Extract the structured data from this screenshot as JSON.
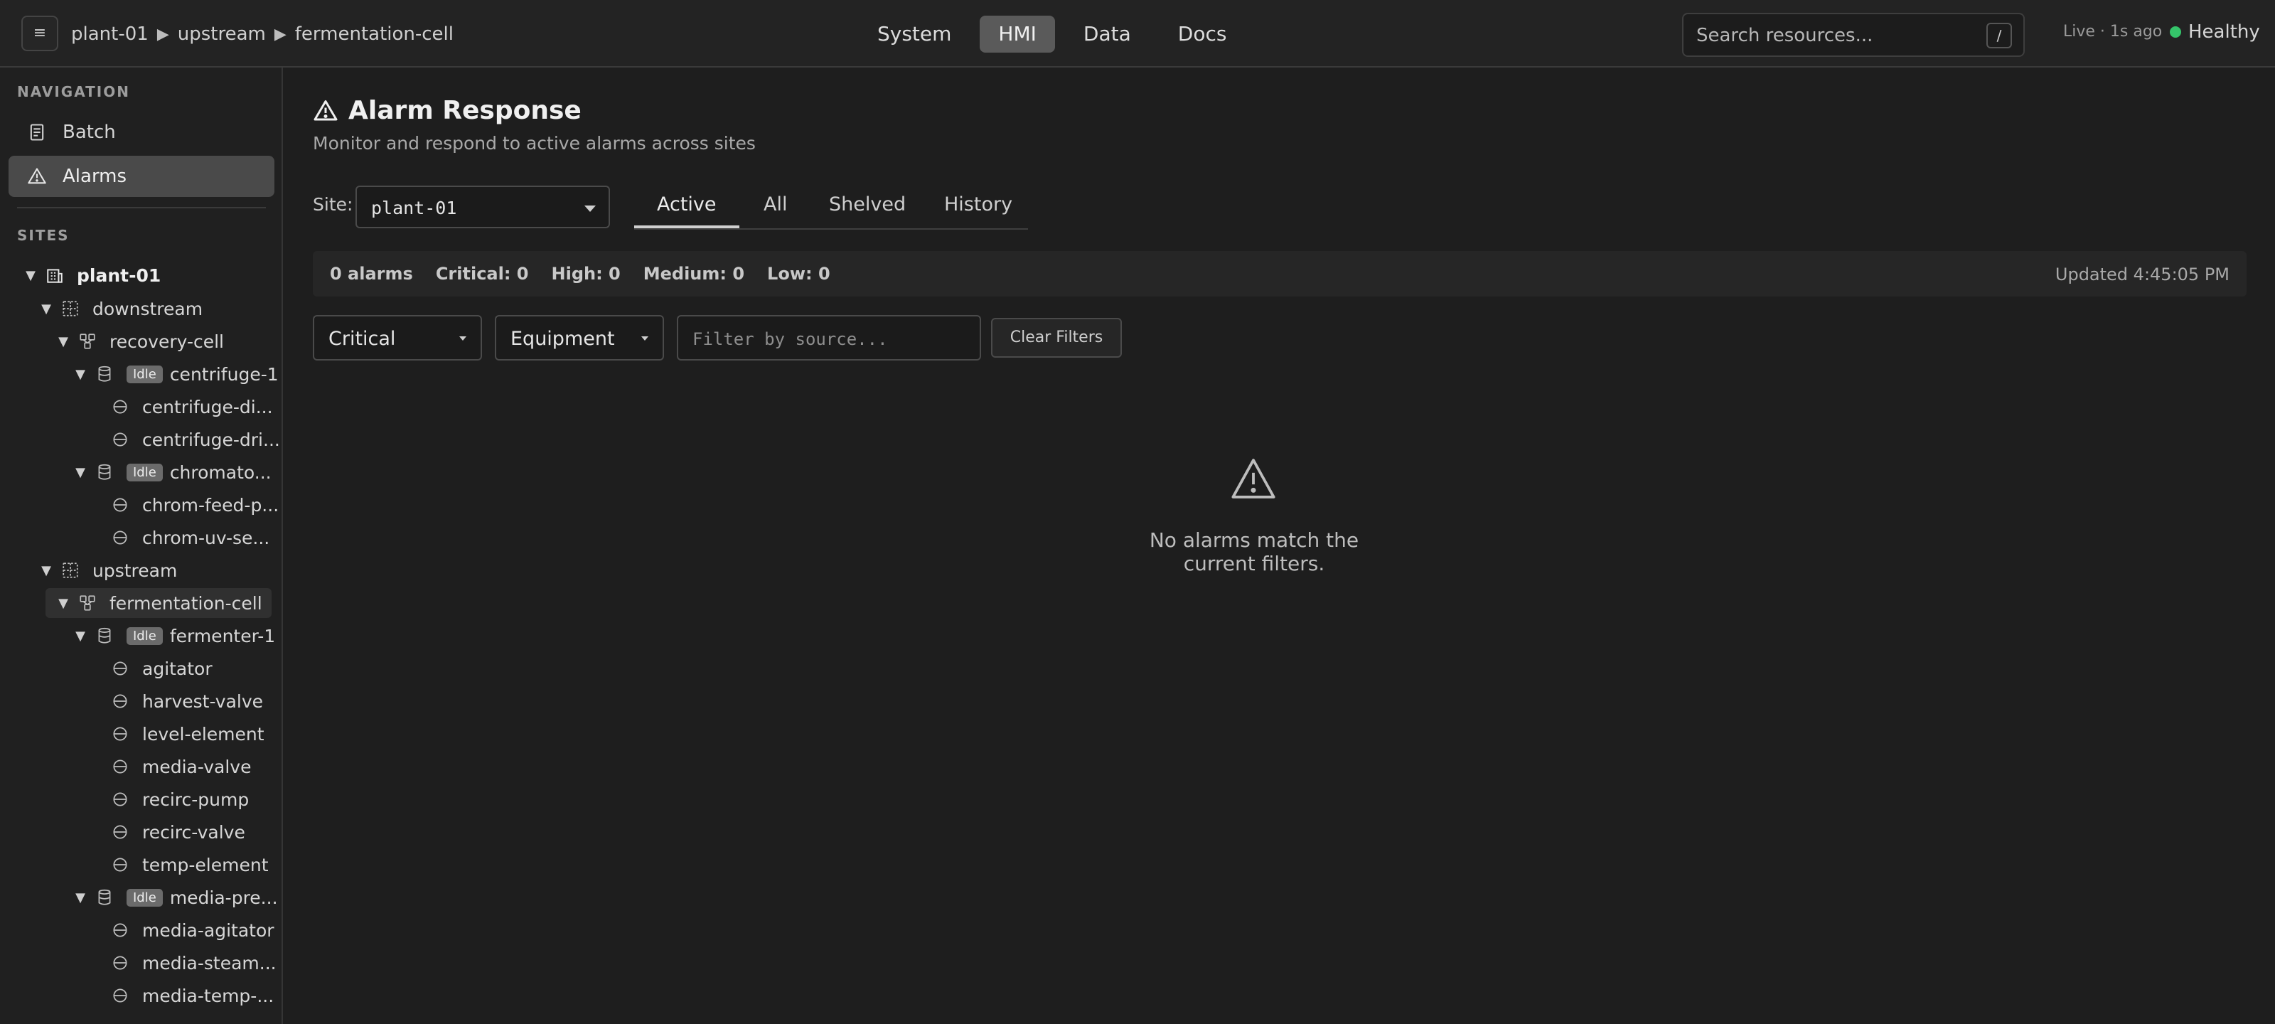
{
  "topbar": {
    "menu_glyph": "≡",
    "breadcrumb": [
      "plant-01",
      "upstream",
      "fermentation-cell"
    ],
    "nav": [
      "System",
      "HMI",
      "Data",
      "Docs"
    ],
    "nav_active": "HMI",
    "search_placeholder": "Search resources...",
    "search_shortcut": "/",
    "live_status": "Live · 1s ago",
    "health": "Healthy",
    "health_color": "#35c46a"
  },
  "sidebar": {
    "nav_heading": "NAVIGATION",
    "nav_items": [
      {
        "label": "Batch",
        "icon": "document-icon"
      },
      {
        "label": "Alarms",
        "icon": "warning-icon",
        "active": true
      }
    ],
    "sites_heading": "SITES",
    "tree": {
      "site": "plant-01",
      "downstream": "downstream",
      "recovery_cell": "recovery-cell",
      "idle_badge": "Idle",
      "centrifuge": "centrifuge-1",
      "centrifuge_children": [
        "centrifuge-di...",
        "centrifuge-dri..."
      ],
      "chromato": "chromato...",
      "chromato_children": [
        "chrom-feed-p...",
        "chrom-uv-se..."
      ],
      "upstream": "upstream",
      "fermentation_cell": "fermentation-cell",
      "fermenter": "fermenter-1",
      "fermenter_children": [
        "agitator",
        "harvest-valve",
        "level-element",
        "media-valve",
        "recirc-pump",
        "recirc-valve",
        "temp-element"
      ],
      "media_pre": "media-pre...",
      "media_children": [
        "media-agitator",
        "media-steam...",
        "media-temp-..."
      ]
    }
  },
  "main": {
    "title": "Alarm Response",
    "subtitle": "Monitor and respond to active alarms across sites",
    "site_label": "Site:",
    "site_value": "plant-01",
    "tabs": [
      "Active",
      "All",
      "Shelved",
      "History"
    ],
    "active_tab": "Active",
    "summary": {
      "alarms": "0 alarms",
      "critical": "Critical: 0",
      "high": "High: 0",
      "medium": "Medium: 0",
      "low": "Low: 0",
      "updated": "Updated 4:45:05 PM"
    },
    "filters": {
      "severity": "Critical",
      "category": "Equipment",
      "source_placeholder": "Filter by source...",
      "clear": "Clear Filters"
    },
    "empty_message": "No alarms match the current filters."
  }
}
